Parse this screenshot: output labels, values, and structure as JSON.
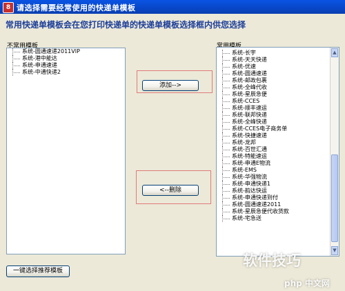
{
  "window": {
    "title": "请选择需要经常使用的快递单模板",
    "icon_glyph": "8"
  },
  "heading": "常用快递单模板会在您打印快递单的快递单模板选择框内供您选择",
  "left_panel": {
    "label": "不常用模板",
    "items": [
      "系统-圆通速递2011VIP",
      "系统-港中能达",
      "系统-申通速递",
      "系统-中通快递2"
    ]
  },
  "right_panel": {
    "label": "常用模板",
    "items": [
      "系统-长宇",
      "系统-天天快递",
      "系统-优速",
      "系统-圆通速递",
      "系统-邮政包裹",
      "系统-全峰代收",
      "系统-星辰急便",
      "系统-CCES",
      "系统-顺丰速运",
      "系统-联邦快递",
      "系统-全峰快递",
      "系统-CCES电子商务单",
      "系统-快捷速递",
      "系统-龙邦",
      "系统-百世汇通",
      "系统-特能速运",
      "系统-申通E物流",
      "系统-EMS",
      "系统-华强物流",
      "系统-申通快递1",
      "系统-韵达快运",
      "系统-申通快递到付",
      "系统-圆通速递2011",
      "系统-星辰急便代收货款",
      "系统-宅急送"
    ]
  },
  "buttons": {
    "add": "添加-->",
    "remove": "<--删除",
    "select_recommended": "一键选择推荐模板"
  },
  "watermark": {
    "text": "软件技巧",
    "site": "php 中文网"
  }
}
